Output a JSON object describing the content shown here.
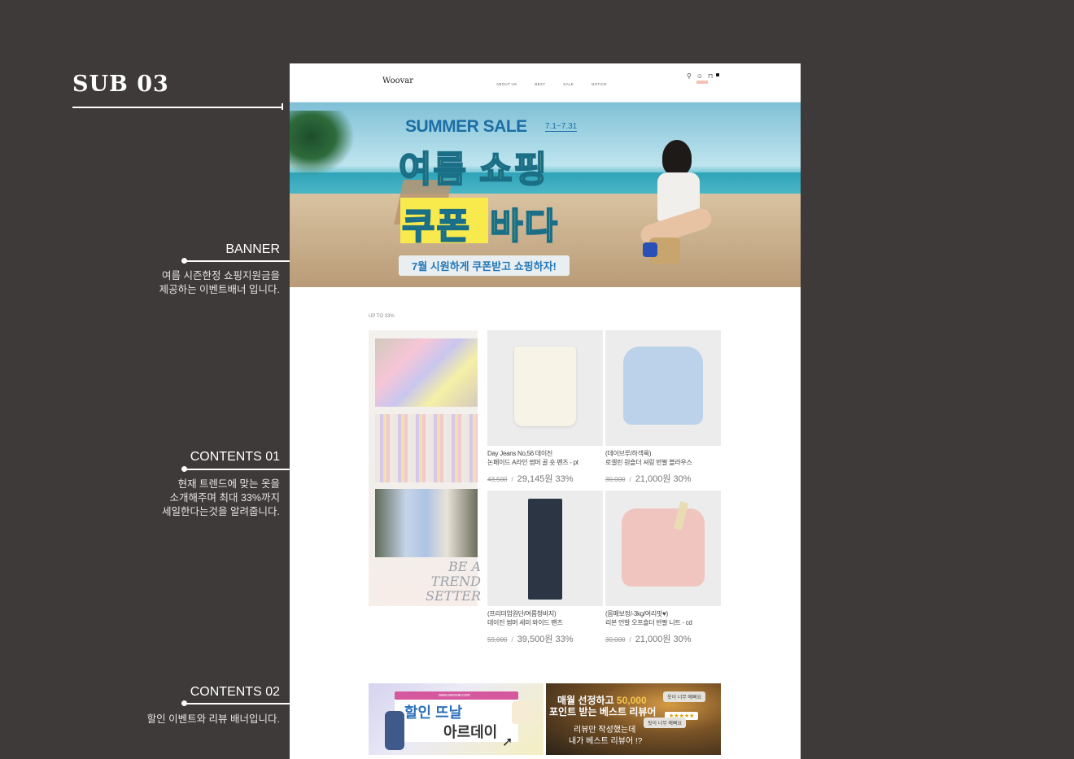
{
  "section_title": "SUB 03",
  "annotations": {
    "banner": {
      "title": "BANNER",
      "desc": [
        "여름 시즌한정 쇼핑지원금을",
        "제공하는 이벤트배너 입니다."
      ]
    },
    "contents01": {
      "title": "CONTENTS 01",
      "desc": [
        "현재 트렌드에 맞는 옷을",
        "소개해주며 최대 33%까지",
        "세일한다는것을 알려줍니다."
      ]
    },
    "contents02": {
      "title": "CONTENTS 02",
      "desc": [
        "할인 이벤트와 리뷰 배너입니다."
      ]
    }
  },
  "mockup": {
    "logo": "Woovar",
    "nav": [
      "ABOUT US",
      "BEST",
      "SALE",
      "NOTICE"
    ],
    "icons": [
      "search-icon",
      "user-icon",
      "cart-icon"
    ],
    "banner": {
      "headline_en": "SUMMER SALE",
      "dates": "7.1~7.31",
      "headline_kr_1": "여름 쇼핑",
      "headline_kr_2a": "쿠폰",
      "headline_kr_2b": "바다",
      "tagline": "7월 시원하게 쿠폰받고 쇼핑하자!"
    },
    "section_label": "UP TO 33%",
    "lookbook_text": [
      "BE A",
      "TREND",
      "SETTER"
    ],
    "products": [
      {
        "name1": "Day Jeans No,56 데이진",
        "name2": "논페이드 A라인 썸머 골 숏 팬츠 - pt",
        "old_price": "43,500",
        "sep": "/",
        "price": "29,145원 33%"
      },
      {
        "name1": "(데이브루/하객룩)",
        "name2": "로셀린 원숄더 셔링 반팔 블라우스",
        "old_price": "30,000",
        "sep": "/",
        "price": "21,000원 30%"
      },
      {
        "name1": "(프리미엄원단/여름청바지)",
        "name2": "데이진 썸머 세미 와이드 팬츠",
        "old_price": "59,000",
        "sep": "/",
        "price": "39,500원 33%"
      },
      {
        "name1": "(몸매보정/-3kg/여리핏♥)",
        "name2": "리본 언발 오프숄더 반팔 니트 - cd",
        "old_price": "30,000",
        "sep": "/",
        "price": "21,000원 30%"
      }
    ],
    "event_banner": {
      "url": "www.woovar.com",
      "line1": "할인 뜨날",
      "line2": "아르데이"
    },
    "review_banner": {
      "line1_a": "매월 선정하고 ",
      "line1_b": "50,000",
      "line2": "포인트 받는 베스트 리뷰어",
      "line3": "리뷰만 작성했는데",
      "line4": "내가 베스트 리뷰어 !?",
      "bubble1": "옷이 너무 예뻐요",
      "stars": "★★★★★",
      "bubble2": "핏이 너무 예뻐요"
    }
  },
  "colors": {
    "background": "#3d3a39",
    "accent_blue": "#1c6ea4",
    "sale_yellow": "#f8e94c",
    "sale_green": "#c9f07a"
  }
}
